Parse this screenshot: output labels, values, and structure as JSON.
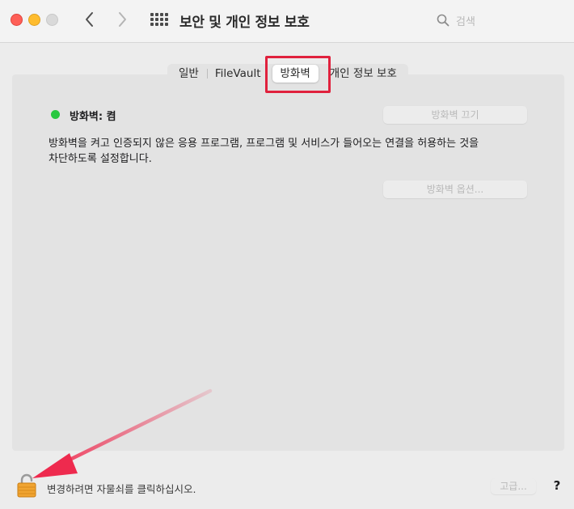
{
  "window": {
    "title": "보안 및 개인 정보 보호",
    "search_placeholder": "검색"
  },
  "tabs": [
    {
      "label": "일반",
      "active": false
    },
    {
      "label": "FileVault",
      "active": false
    },
    {
      "label": "방화벽",
      "active": true
    },
    {
      "label": "개인 정보 보호",
      "active": false
    }
  ],
  "firewall": {
    "status_label": "방화벽: 켬",
    "status_color": "#28c840",
    "turn_off_button": "방화벽 끄기",
    "description_line1": "방화벽을 켜고 인증되지 않은 응용 프로그램, 프로그램 및 서비스가 들어오는 연결을 허용하는 것을",
    "description_line2": "차단하도록 설정합니다.",
    "options_button": "방화벽 옵션..."
  },
  "footer": {
    "lock_text": "변경하려면 자물쇠를 클릭하십시오.",
    "advanced_button": "고급...",
    "help_button": "?"
  },
  "annotations": {
    "highlight_color": "#e0213d",
    "arrow_color": "#ee2a4e"
  }
}
